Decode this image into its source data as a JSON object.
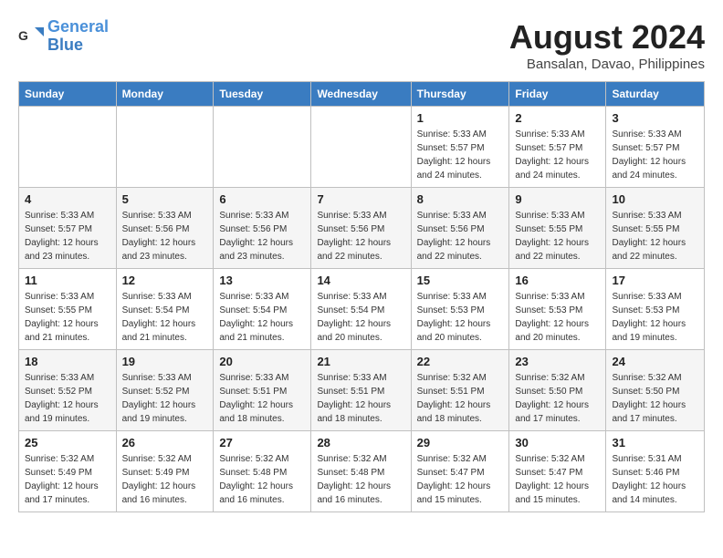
{
  "header": {
    "logo_line1": "General",
    "logo_line2": "Blue",
    "month_year": "August 2024",
    "location": "Bansalan, Davao, Philippines"
  },
  "weekdays": [
    "Sunday",
    "Monday",
    "Tuesday",
    "Wednesday",
    "Thursday",
    "Friday",
    "Saturday"
  ],
  "weeks": [
    [
      {
        "day": "",
        "info": ""
      },
      {
        "day": "",
        "info": ""
      },
      {
        "day": "",
        "info": ""
      },
      {
        "day": "",
        "info": ""
      },
      {
        "day": "1",
        "info": "Sunrise: 5:33 AM\nSunset: 5:57 PM\nDaylight: 12 hours\nand 24 minutes."
      },
      {
        "day": "2",
        "info": "Sunrise: 5:33 AM\nSunset: 5:57 PM\nDaylight: 12 hours\nand 24 minutes."
      },
      {
        "day": "3",
        "info": "Sunrise: 5:33 AM\nSunset: 5:57 PM\nDaylight: 12 hours\nand 24 minutes."
      }
    ],
    [
      {
        "day": "4",
        "info": "Sunrise: 5:33 AM\nSunset: 5:57 PM\nDaylight: 12 hours\nand 23 minutes."
      },
      {
        "day": "5",
        "info": "Sunrise: 5:33 AM\nSunset: 5:56 PM\nDaylight: 12 hours\nand 23 minutes."
      },
      {
        "day": "6",
        "info": "Sunrise: 5:33 AM\nSunset: 5:56 PM\nDaylight: 12 hours\nand 23 minutes."
      },
      {
        "day": "7",
        "info": "Sunrise: 5:33 AM\nSunset: 5:56 PM\nDaylight: 12 hours\nand 22 minutes."
      },
      {
        "day": "8",
        "info": "Sunrise: 5:33 AM\nSunset: 5:56 PM\nDaylight: 12 hours\nand 22 minutes."
      },
      {
        "day": "9",
        "info": "Sunrise: 5:33 AM\nSunset: 5:55 PM\nDaylight: 12 hours\nand 22 minutes."
      },
      {
        "day": "10",
        "info": "Sunrise: 5:33 AM\nSunset: 5:55 PM\nDaylight: 12 hours\nand 22 minutes."
      }
    ],
    [
      {
        "day": "11",
        "info": "Sunrise: 5:33 AM\nSunset: 5:55 PM\nDaylight: 12 hours\nand 21 minutes."
      },
      {
        "day": "12",
        "info": "Sunrise: 5:33 AM\nSunset: 5:54 PM\nDaylight: 12 hours\nand 21 minutes."
      },
      {
        "day": "13",
        "info": "Sunrise: 5:33 AM\nSunset: 5:54 PM\nDaylight: 12 hours\nand 21 minutes."
      },
      {
        "day": "14",
        "info": "Sunrise: 5:33 AM\nSunset: 5:54 PM\nDaylight: 12 hours\nand 20 minutes."
      },
      {
        "day": "15",
        "info": "Sunrise: 5:33 AM\nSunset: 5:53 PM\nDaylight: 12 hours\nand 20 minutes."
      },
      {
        "day": "16",
        "info": "Sunrise: 5:33 AM\nSunset: 5:53 PM\nDaylight: 12 hours\nand 20 minutes."
      },
      {
        "day": "17",
        "info": "Sunrise: 5:33 AM\nSunset: 5:53 PM\nDaylight: 12 hours\nand 19 minutes."
      }
    ],
    [
      {
        "day": "18",
        "info": "Sunrise: 5:33 AM\nSunset: 5:52 PM\nDaylight: 12 hours\nand 19 minutes."
      },
      {
        "day": "19",
        "info": "Sunrise: 5:33 AM\nSunset: 5:52 PM\nDaylight: 12 hours\nand 19 minutes."
      },
      {
        "day": "20",
        "info": "Sunrise: 5:33 AM\nSunset: 5:51 PM\nDaylight: 12 hours\nand 18 minutes."
      },
      {
        "day": "21",
        "info": "Sunrise: 5:33 AM\nSunset: 5:51 PM\nDaylight: 12 hours\nand 18 minutes."
      },
      {
        "day": "22",
        "info": "Sunrise: 5:32 AM\nSunset: 5:51 PM\nDaylight: 12 hours\nand 18 minutes."
      },
      {
        "day": "23",
        "info": "Sunrise: 5:32 AM\nSunset: 5:50 PM\nDaylight: 12 hours\nand 17 minutes."
      },
      {
        "day": "24",
        "info": "Sunrise: 5:32 AM\nSunset: 5:50 PM\nDaylight: 12 hours\nand 17 minutes."
      }
    ],
    [
      {
        "day": "25",
        "info": "Sunrise: 5:32 AM\nSunset: 5:49 PM\nDaylight: 12 hours\nand 17 minutes."
      },
      {
        "day": "26",
        "info": "Sunrise: 5:32 AM\nSunset: 5:49 PM\nDaylight: 12 hours\nand 16 minutes."
      },
      {
        "day": "27",
        "info": "Sunrise: 5:32 AM\nSunset: 5:48 PM\nDaylight: 12 hours\nand 16 minutes."
      },
      {
        "day": "28",
        "info": "Sunrise: 5:32 AM\nSunset: 5:48 PM\nDaylight: 12 hours\nand 16 minutes."
      },
      {
        "day": "29",
        "info": "Sunrise: 5:32 AM\nSunset: 5:47 PM\nDaylight: 12 hours\nand 15 minutes."
      },
      {
        "day": "30",
        "info": "Sunrise: 5:32 AM\nSunset: 5:47 PM\nDaylight: 12 hours\nand 15 minutes."
      },
      {
        "day": "31",
        "info": "Sunrise: 5:31 AM\nSunset: 5:46 PM\nDaylight: 12 hours\nand 14 minutes."
      }
    ]
  ]
}
